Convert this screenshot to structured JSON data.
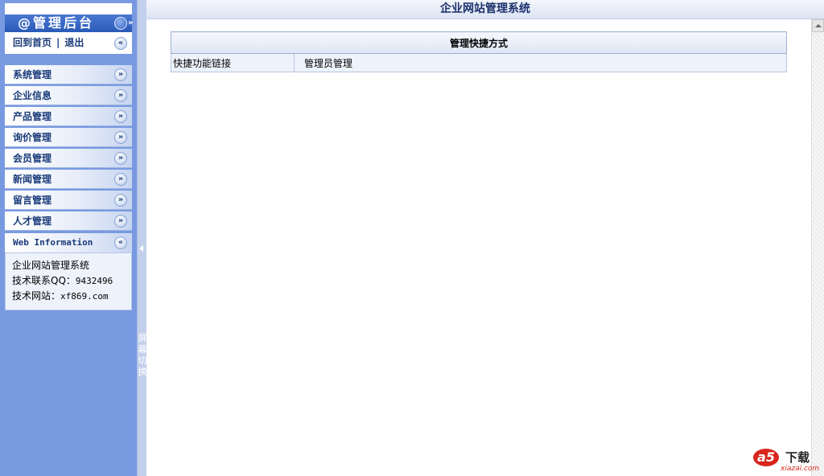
{
  "window": {
    "title": "企业网站管理系统"
  },
  "sidebar": {
    "header_label": "@管理后台",
    "header_icon": "chevron-double-down-icon",
    "home_link": "回到首页",
    "separator": "|",
    "logout_link": "退出",
    "collapse_icon": "chevron-double-left-icon",
    "items": [
      {
        "label": "系统管理",
        "icon": "chevron-double-down-icon"
      },
      {
        "label": "企业信息",
        "icon": "chevron-double-down-icon"
      },
      {
        "label": "产品管理",
        "icon": "chevron-double-down-icon"
      },
      {
        "label": "询价管理",
        "icon": "chevron-double-down-icon"
      },
      {
        "label": "会员管理",
        "icon": "chevron-double-down-icon"
      },
      {
        "label": "新闻管理",
        "icon": "chevron-double-down-icon"
      },
      {
        "label": "留言管理",
        "icon": "chevron-double-down-icon"
      },
      {
        "label": "人才管理",
        "icon": "chevron-double-down-icon"
      }
    ],
    "info_panel": {
      "title": "Web Information",
      "lines": [
        "企业网站管理系统",
        "技术联系QQ：",
        "9432496",
        "技术网站：",
        "xf869.com"
      ]
    }
  },
  "splitter": {
    "label": "屏幕切换"
  },
  "main": {
    "table": {
      "header": "管理快捷方式",
      "rows": [
        {
          "label": "快捷功能链接",
          "link": "管理员管理"
        }
      ]
    }
  },
  "watermark": {
    "logo_text": "a5",
    "label": "下载",
    "site": "xiazai.com"
  },
  "colors": {
    "sidebar_bg": "#799ae1",
    "header_bg": "#2a5ab8",
    "menu_text": "#1a3b7a",
    "title_text": "#1a2f6a",
    "watermark_red": "#d8261d"
  }
}
